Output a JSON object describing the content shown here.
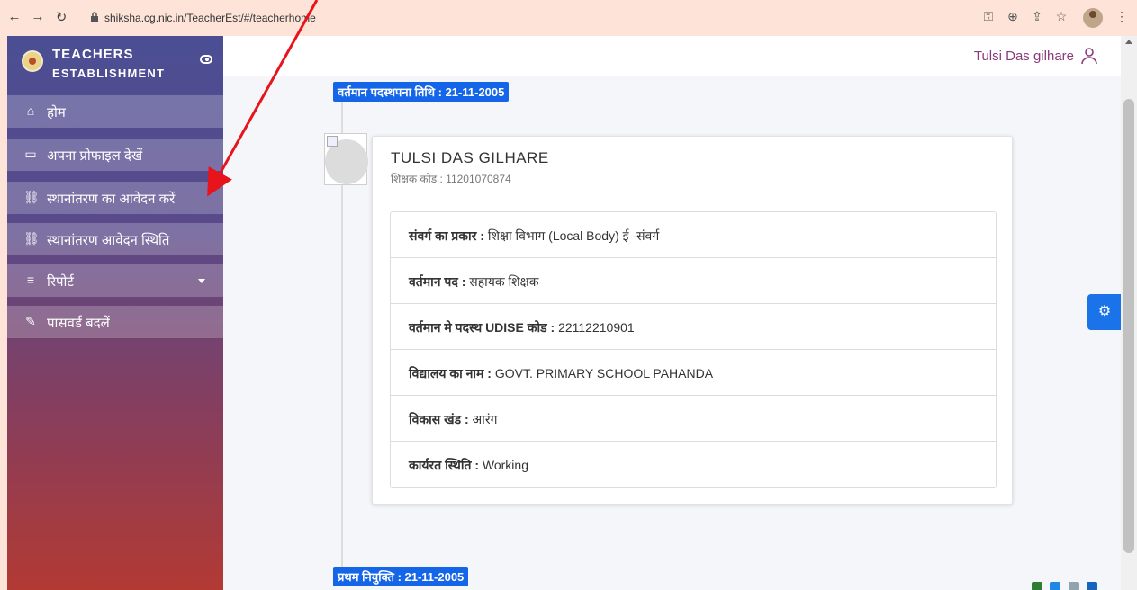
{
  "browser": {
    "url": "shiksha.cg.nic.in/TeacherEst/#/teacherhome"
  },
  "sidebar": {
    "brand_line1": "TEACHERS",
    "brand_line2": "ESTABLISHMENT",
    "items": [
      {
        "label": "होम",
        "icon": "home-icon"
      },
      {
        "label": "अपना प्रोफाइल देखें",
        "icon": "book-icon"
      },
      {
        "label": "स्थानांतरण का आवेदन करें",
        "icon": "link-icon"
      },
      {
        "label": "स्थानांतरण आवेदन स्थिति",
        "icon": "link-icon"
      },
      {
        "label": "रिपोर्ट",
        "icon": "list-icon",
        "has_dropdown": true
      },
      {
        "label": "पासवर्ड बदलें",
        "icon": "edit-icon"
      }
    ]
  },
  "header": {
    "username": "Tulsi Das gilhare"
  },
  "timeline": {
    "current_posting_date": "वर्तमान पदस्थपना तिथि : 21-11-2005",
    "first_appointment": "प्रथम नियुक्ति : 21-11-2005"
  },
  "profile": {
    "name": "TULSI DAS GILHARE",
    "teacher_code": "शिक्षक कोड : 11201070874",
    "details": [
      {
        "label": "संवर्ग का प्रकार :",
        "value": "शिक्षा विभाग (Local Body) ई -संवर्ग"
      },
      {
        "label": "वर्तमान पद :",
        "value": "सहायक शिक्षक"
      },
      {
        "label": "वर्तमान मे पदस्थ UDISE कोड :",
        "value": "22112210901"
      },
      {
        "label": "विद्यालय का नाम :",
        "value": "GOVT. PRIMARY SCHOOL PAHANDA"
      },
      {
        "label": "विकास खंड :",
        "value": "आरंग"
      },
      {
        "label": "कार्यरत स्थिति :",
        "value": "Working"
      }
    ]
  },
  "colors": {
    "accent": "#1565e8",
    "annotation_arrow": "#e8141c",
    "username": "#8b3a7a"
  }
}
